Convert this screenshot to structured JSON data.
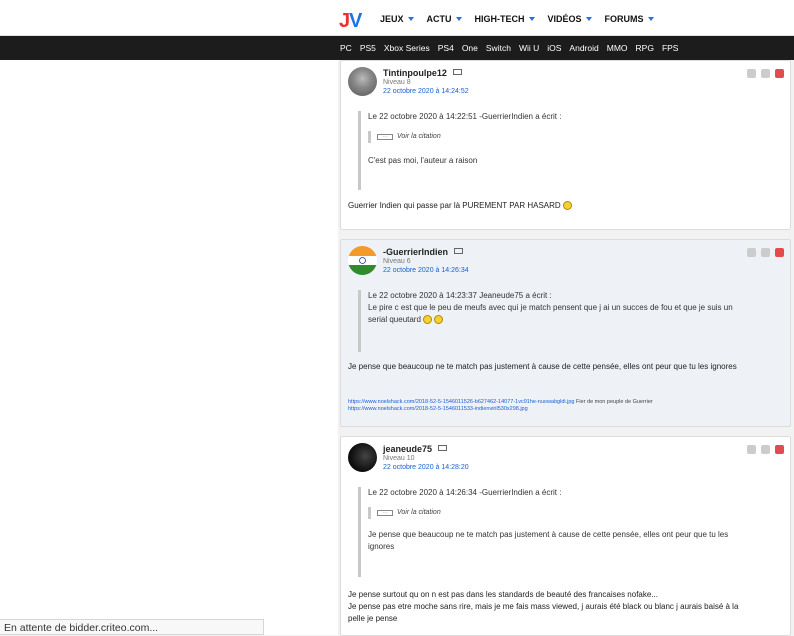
{
  "header": {
    "nav": [
      "JEUX",
      "ACTU",
      "HIGH-TECH",
      "VIDÉOS",
      "FORUMS"
    ],
    "platforms": [
      "PC",
      "PS5",
      "Xbox Series",
      "PS4",
      "One",
      "Switch",
      "Wii U",
      "iOS",
      "Android",
      "MMO",
      "RPG",
      "FPS"
    ]
  },
  "colors": {
    "accent": "#1a73e8",
    "logo_red": "#e8322e",
    "logo_blue": "#1a73e8",
    "subbar": "#1c1c1c"
  },
  "status": "En attente de bidder.criteo.com...",
  "posts": [
    {
      "author": "Tintinpoulpe12",
      "level": "Niveau 8",
      "date": "22 octobre 2020 à 14:24:52",
      "quote_header": "Le 22 octobre 2020 à 14:22:51 -GuerrierIndien a écrit :",
      "voir": "Voir la citation",
      "quote_text": "C'est pas moi, l'auteur a raison",
      "body": "Guerrier Indien qui passe par là PUREMENT PAR HASARD"
    },
    {
      "author": "-GuerrierIndien",
      "level": "Niveau 6",
      "date": "22 octobre 2020 à 14:26:34",
      "quote_header": "Le 22 octobre 2020 à 14:23:37 Jeaneude75 a écrit :",
      "quote_text_1": "Le pire c est que le peu de meufs avec qui je match pensent que j ai un succes de fou et que je suis un",
      "quote_text_2": "serial queutard",
      "body": "Je pense que beaucoup ne te match pas justement à cause de cette pensée, elles ont peur que tu les ignores",
      "link1": "https://www.noelshack.com/2018-52-5-1546011526-b627462-14077-1vc91he-nuowabgldi.jpg",
      "link1_note": "Fier de mon peuple de Guerrier",
      "link2": "https://www.noelshack.com/2018-52-5-1546011533-indienviril530x298.jpg"
    },
    {
      "author": "jeaneude75",
      "level": "Niveau 10",
      "date": "22 octobre 2020 à 14:28:20",
      "quote_header": "Le 22 octobre 2020 à 14:26:34 -GuerrierIndien a écrit :",
      "voir": "Voir la citation",
      "quote_text_1": "Je pense que beaucoup ne te match pas justement à cause de cette pensée, elles ont peur que tu les",
      "quote_text_2": "ignores",
      "body_1": "Je pense surtout qu on n est pas dans les standards de beauté des francaises nofake...",
      "body_2": "Je pense pas etre moche sans rire, mais je me fais mass viewed, j aurais été black ou blanc j aurais baisé à la",
      "body_3": "pelle je pense"
    }
  ]
}
